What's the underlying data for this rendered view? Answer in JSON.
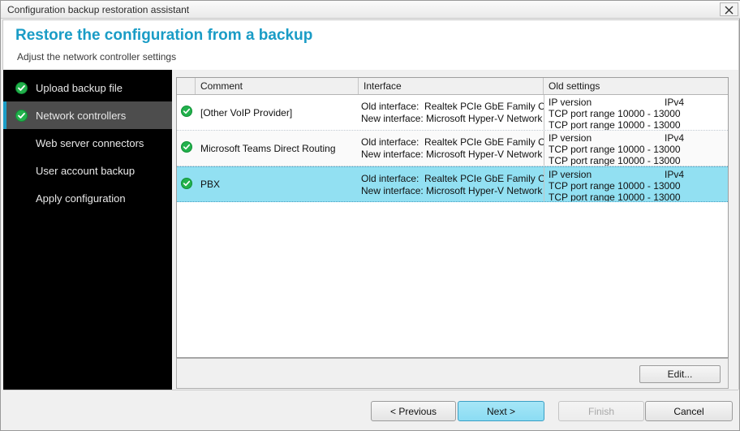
{
  "window": {
    "title": "Configuration backup restoration assistant",
    "close_icon": "close-icon"
  },
  "header": {
    "title": "Restore the configuration from a backup",
    "subtitle": "Adjust the network controller settings",
    "title_color": "#1a9cc6"
  },
  "sidebar": {
    "items": [
      {
        "label": "Upload backup file",
        "checked": true,
        "active": false
      },
      {
        "label": "Network controllers",
        "checked": true,
        "active": true
      },
      {
        "label": "Web server connectors",
        "checked": false,
        "active": false
      },
      {
        "label": "User account backup",
        "checked": false,
        "active": false
      },
      {
        "label": "Apply configuration",
        "checked": false,
        "active": false
      }
    ],
    "check_color": "#22b14c",
    "active_bg": "#4d4d4d",
    "background": "#000000"
  },
  "table": {
    "columns": [
      "",
      "Comment",
      "Interface",
      "Old settings"
    ],
    "rows": [
      {
        "status_icon": "check-circle-icon",
        "comment": "[Other VoIP Provider]",
        "interface_old_label": "Old interface:",
        "interface_old_value": "Realtek PCIe GbE Family Cont",
        "interface_new_label": "New interface:",
        "interface_new_value": "Microsoft Hyper-V Network Ada",
        "settings": [
          "IP version",
          "TCP port range 10000 - 13000",
          "TCP port range 10000 - 13000"
        ],
        "ip_version": "IPv4",
        "selected": false
      },
      {
        "status_icon": "check-circle-icon",
        "comment": "Microsoft Teams Direct Routing",
        "interface_old_label": "Old interface:",
        "interface_old_value": "Realtek PCIe GbE Family Cont",
        "interface_new_label": "New interface:",
        "interface_new_value": "Microsoft Hyper-V Network Ada",
        "settings": [
          "IP version",
          "TCP port range 10000 - 13000",
          "TCP port range 10000 - 13000"
        ],
        "ip_version": "IPv4",
        "selected": false
      },
      {
        "status_icon": "check-circle-icon",
        "comment": "PBX",
        "interface_old_label": "Old interface:",
        "interface_old_value": "Realtek PCIe GbE Family Cont",
        "interface_new_label": "New interface:",
        "interface_new_value": "Microsoft Hyper-V Network Ada",
        "settings": [
          "IP version",
          "TCP port range 10000 - 13000",
          "TCP port range 10000 - 13000"
        ],
        "ip_version": "IPv4",
        "selected": true
      }
    ],
    "selected_row_color": "#92e0f2"
  },
  "actions": {
    "edit": "Edit..."
  },
  "footer": {
    "previous": "< Previous",
    "next": "Next >",
    "finish": "Finish",
    "cancel": "Cancel",
    "next_accent": "#8bdcf3",
    "finish_disabled": true
  }
}
